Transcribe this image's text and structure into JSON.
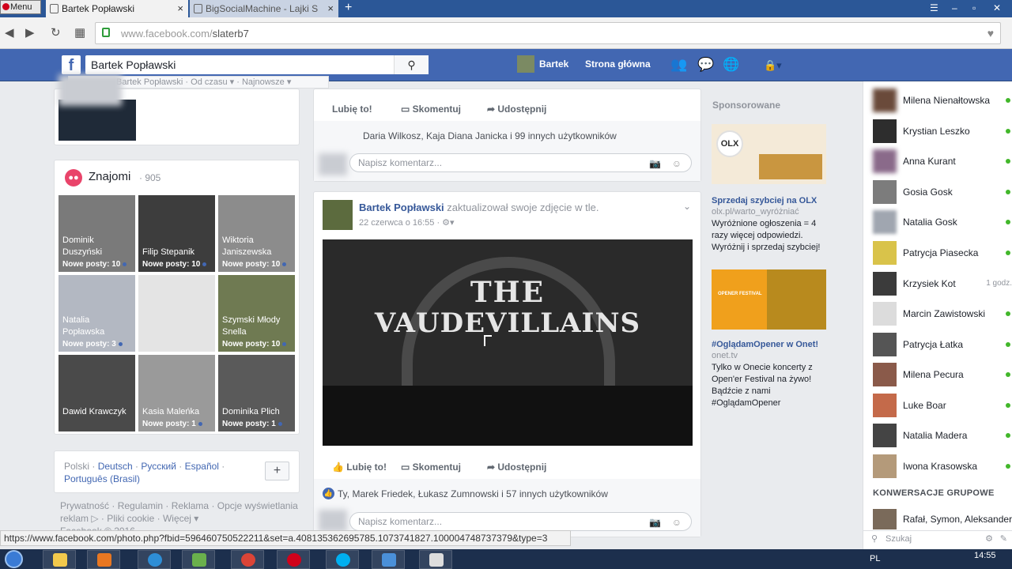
{
  "browser": {
    "menu_label": "Menu",
    "tabs": [
      {
        "title": "Bartek Popławski",
        "close": "×"
      },
      {
        "title": "BigSocialMachine - Lajki S",
        "close": "×"
      }
    ],
    "new_tab": "+",
    "url_domain": "www.facebook.com/",
    "url_path": "slaterb7"
  },
  "fb_header": {
    "logo": "f",
    "search_value": "Bartek Popławski",
    "user_name": "Bartek",
    "home_label": "Strona główna"
  },
  "left": {
    "filter_text": "Bartek Popławski · Od czasu ▾ · Najnowsze ▾",
    "friends_title": "Znajomi",
    "friends_count": "· 905",
    "friends": [
      {
        "name": "Dominik Duszyński",
        "new_posts": "Nowe posty: 10"
      },
      {
        "name": "Filip Stepanik",
        "new_posts": "Nowe posty: 10"
      },
      {
        "name": "Wiktoria Janiszewska",
        "new_posts": "Nowe posty: 10"
      },
      {
        "name": "Natalia Popławska",
        "new_posts": "Nowe posty: 3"
      },
      {
        "name": "",
        "new_posts": ""
      },
      {
        "name": "Szymski Młody Snella",
        "new_posts": "Nowe posty: 10"
      },
      {
        "name": "Dawid Krawczyk",
        "new_posts": ""
      },
      {
        "name": "Kasia Maleńka",
        "new_posts": "Nowe posty: 1"
      },
      {
        "name": "Dominika Plich",
        "new_posts": "Nowe posty: 1"
      }
    ],
    "languages": [
      "Polski",
      "Deutsch",
      "Русский",
      "Español",
      "Português (Brasil)"
    ],
    "add_language": "+",
    "footer": [
      "Prywatność",
      "Regulamin",
      "Reklama",
      "Opcje wyświetlania reklam ▷",
      "Pliki cookie",
      "Więcej ▾",
      "Facebook © 2016"
    ]
  },
  "feed": {
    "top_post": {
      "like": "Lubię to!",
      "comment": "Skomentuj",
      "share": "Udostępnij",
      "likes_line": "Daria Wilkosz, Kaja Diana Janicka i 99 innych użytkowników",
      "comment_placeholder": "Napisz komentarz..."
    },
    "post": {
      "author": "Bartek Popławski",
      "action": "zaktualizował swoje zdjęcie w tle.",
      "date": "22 czerwca o 16:55 · ",
      "photo_line1": "THE",
      "photo_line2": "VAUDEVILLAINS",
      "like": "Lubię to!",
      "comment": "Skomentuj",
      "share": "Udostępnij",
      "likes_line": "Ty, Marek Friedek, Łukasz Zumnowski i 57 innych użytkowników",
      "comment_placeholder": "Napisz komentarz..."
    }
  },
  "ads": {
    "sponsored_label": "Sponsorowane",
    "items": [
      {
        "logo": "OLX",
        "title": "Sprzedaj szybciej na OLX",
        "url": "olx.pl/warto_wyróżniać",
        "desc": "Wyróżnione ogłoszenia = 4 razy więcej odpowiedzi. Wyróżnij i sprzedaj szybciej!"
      },
      {
        "logo": "OPENER FESTIVAL",
        "title": "#OglądamOpener w Onet!",
        "url": "onet.tv",
        "desc": "Tylko w Onecie koncerty z Open'er Festival na żywo! Bądźcie z nami #OglądamOpener"
      }
    ]
  },
  "chat": {
    "contacts": [
      {
        "name": "Milena Nienałtowska",
        "time": ""
      },
      {
        "name": "Krystian Leszko",
        "time": ""
      },
      {
        "name": "Anna Kurant",
        "time": ""
      },
      {
        "name": "Gosia Gosk",
        "time": ""
      },
      {
        "name": "Natalia Gosk",
        "time": ""
      },
      {
        "name": "Patrycja Piasecka",
        "time": ""
      },
      {
        "name": "Krzysiek Kot",
        "time": "1 godz."
      },
      {
        "name": "Marcin Zawistowski",
        "time": ""
      },
      {
        "name": "Patrycja Łatka",
        "time": ""
      },
      {
        "name": "Milena Pecura",
        "time": ""
      },
      {
        "name": "Luke Boar",
        "time": ""
      },
      {
        "name": "Natalia Madera",
        "time": ""
      },
      {
        "name": "Iwona Krasowska",
        "time": ""
      }
    ],
    "group_title": "KONWERSACJE GRUPOWE",
    "group_name": "Rafał, Symon, Aleksander",
    "search_placeholder": "Szukaj"
  },
  "status_url": "https://www.facebook.com/photo.php?fbid=596460750522211&set=a.408135362695785.1073741827.100004748737379&type=3",
  "taskbar": {
    "lang": "PL",
    "time": "14:55"
  },
  "colors": {
    "fb_blue": "#4267b2",
    "link": "#365899",
    "online": "#42b72a",
    "accent_red": "#e9446a"
  }
}
